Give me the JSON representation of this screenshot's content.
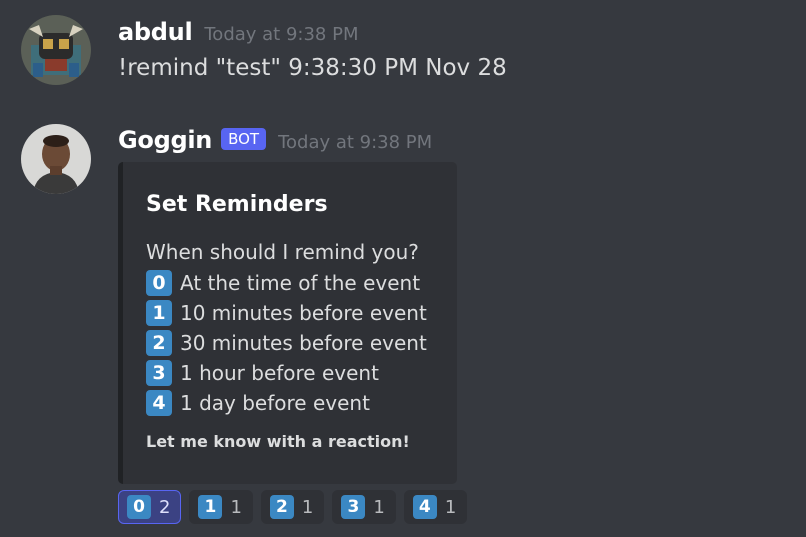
{
  "messages": [
    {
      "username": "abdul",
      "timestamp": "Today at 9:38 PM",
      "content": "!remind \"test\" 9:38:30 PM Nov 28"
    },
    {
      "username": "Goggin",
      "bot_tag": "BOT",
      "timestamp": "Today at 9:38 PM",
      "embed": {
        "title": "Set Reminders",
        "prompt": "When should I remind you?",
        "options": [
          {
            "key": "0",
            "text": "At the time of the event"
          },
          {
            "key": "1",
            "text": "10 minutes before event"
          },
          {
            "key": "2",
            "text": "30 minutes before event"
          },
          {
            "key": "3",
            "text": "1 hour before event"
          },
          {
            "key": "4",
            "text": "1 day before event"
          }
        ],
        "footer": "Let me know with a reaction!"
      },
      "reactions": [
        {
          "emoji": "0",
          "count": "2",
          "active": true
        },
        {
          "emoji": "1",
          "count": "1",
          "active": false
        },
        {
          "emoji": "2",
          "count": "1",
          "active": false
        },
        {
          "emoji": "3",
          "count": "1",
          "active": false
        },
        {
          "emoji": "4",
          "count": "1",
          "active": false
        }
      ]
    }
  ],
  "colors": {
    "background": "#36393f",
    "embed_bg": "#2f3136",
    "keycap_blue": "#3b88c3",
    "bot_tag": "#5865f2",
    "active_reaction": "#3b4283"
  }
}
